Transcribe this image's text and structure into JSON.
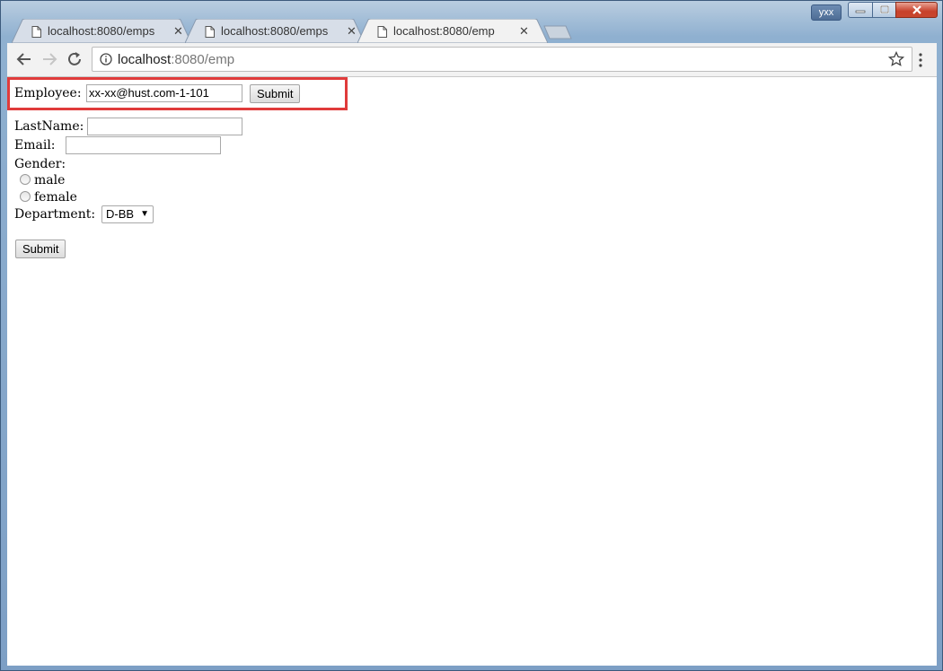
{
  "window": {
    "user": "yxx"
  },
  "tabs": [
    {
      "label": "localhost:8080/emps",
      "active": false
    },
    {
      "label": "localhost:8080/emps",
      "active": false
    },
    {
      "label": "localhost:8080/emp",
      "active": true
    }
  ],
  "toolbar": {
    "url_host": "localhost",
    "url_path": ":8080/emp"
  },
  "page": {
    "employee_label": "Employee:",
    "employee_value": "xx-xx@hust.com-1-101",
    "employee_submit": "Submit",
    "lastname_label": "LastName:",
    "lastname_value": "",
    "email_label": "Email:",
    "email_value": "",
    "gender_label": "Gender:",
    "gender_options": [
      "male",
      "female"
    ],
    "department_label": "Department:",
    "department_selected": "D-BB",
    "submit": "Submit"
  },
  "colors": {
    "highlight": "#e03b3b"
  }
}
